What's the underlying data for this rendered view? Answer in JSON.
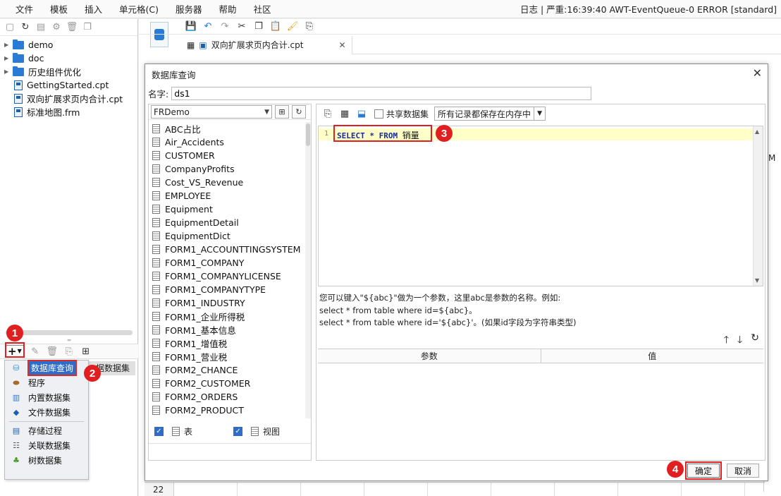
{
  "menubar": {
    "items": [
      "文件",
      "模板",
      "插入",
      "单元格(C)",
      "服务器",
      "帮助",
      "社区"
    ],
    "log": "日志 | 严重:16:39:40 AWT-EventQueue-0 ERROR [standard]"
  },
  "tree": {
    "folders": [
      "demo",
      "doc",
      "历史组件优化"
    ],
    "files": [
      "GettingStarted.cpt",
      "双向扩展求页内合计.cpt",
      "标准地图.frm"
    ]
  },
  "dataset_panel": {
    "list_header": "据数据集"
  },
  "dataset_menu": {
    "items": [
      "数据库查询",
      "程序",
      "内置数据集",
      "文件数据集"
    ],
    "items2": [
      "存储过程",
      "关联数据集",
      "树数据集"
    ]
  },
  "main": {
    "tab_label": "双向扩展求页内合计.cpt",
    "row_22": "22",
    "col_m": "M"
  },
  "dialog": {
    "title": "数据库查询",
    "name_label": "名字:",
    "name_value": "ds1",
    "connection": "FRDemo",
    "tables": [
      "ABC占比",
      "Air_Accidents",
      "CUSTOMER",
      "CompanyProfits",
      "Cost_VS_Revenue",
      "EMPLOYEE",
      "Equipment",
      "EquipmentDetail",
      "EquipmentDict",
      "FORM1_ACCOUNTTINGSYSTEM",
      "FORM1_COMPANY",
      "FORM1_COMPANYLICENSE",
      "FORM1_COMPANYTYPE",
      "FORM1_INDUSTRY",
      "FORM1_企业所得税",
      "FORM1_基本信息",
      "FORM1_增值税",
      "FORM1_营业税",
      "FORM2_CHANCE",
      "FORM2_CUSTOMER",
      "FORM2_ORDERS",
      "FORM2_PRODUCT"
    ],
    "check_table": "表",
    "check_view": "视图",
    "share_label": "共享数据集",
    "store_option": "所有记录都保存在内存中",
    "line_number": "1",
    "sql_keywords": "SELECT * FROM ",
    "sql_table": "销量",
    "hint_lines": [
      "您可以键入\"${abc}\"做为一个参数，这里abc是参数的名称。例如:",
      "select * from table where id=${abc}。",
      "select * from table where id='${abc}'。(如果id字段为字符串类型)"
    ],
    "param_header": "参数",
    "value_header": "值",
    "ok": "确定",
    "cancel": "取消"
  },
  "annotations": [
    "1",
    "2",
    "3",
    "4"
  ],
  "colors": {
    "accent": "#2f6cc7",
    "highlight": "#e02020",
    "sql_line_bg": "#ffffc8"
  }
}
